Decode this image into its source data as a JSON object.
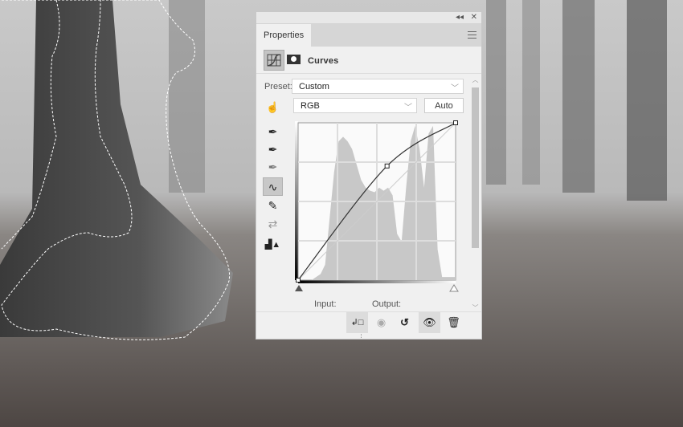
{
  "panel": {
    "tab_label": "Properties",
    "collapse_icon": "double-chevron-left-icon",
    "close_icon": "close-icon",
    "menu_icon": "hamburger-menu-icon",
    "adjustment_title": "Curves",
    "preset_label": "Preset:",
    "preset_value": "Custom",
    "channel_value": "RGB",
    "auto_label": "Auto",
    "input_label": "Input:",
    "output_label": "Output:",
    "tools": [
      "eyedropper-black-icon",
      "eyedropper-gray-icon",
      "eyedropper-white-icon",
      "curve-points-icon",
      "pencil-icon",
      "smooth-curve-icon",
      "clipping-warning-icon"
    ],
    "footer_buttons": [
      "clip-to-layer-icon",
      "view-previous-state-icon",
      "reset-icon",
      "visibility-eye-icon",
      "trash-icon"
    ]
  },
  "curve": {
    "range": [
      0,
      255
    ],
    "points": [
      [
        0,
        0
      ],
      [
        144,
        185
      ],
      [
        255,
        255
      ]
    ]
  },
  "colors": {
    "panel_bg": "#f0f0f0",
    "accent": "#c4c4c4"
  }
}
